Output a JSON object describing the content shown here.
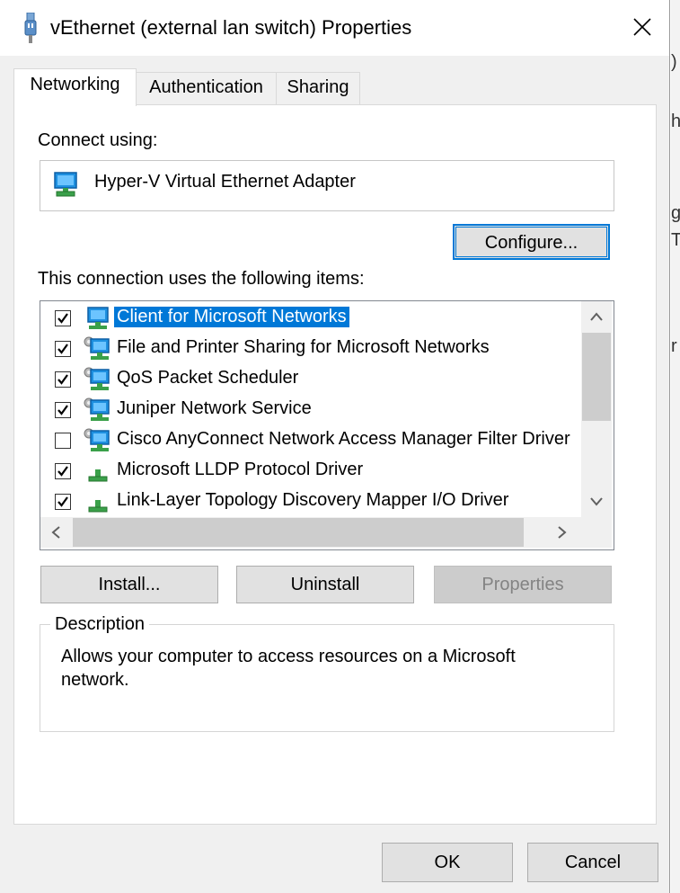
{
  "window": {
    "title": "vEthernet (external lan switch) Properties"
  },
  "background_glyphs": [
    ")",
    "h",
    "g",
    "T",
    "r"
  ],
  "tabs": [
    {
      "label": "Networking",
      "active": true
    },
    {
      "label": "Authentication",
      "active": false
    },
    {
      "label": "Sharing",
      "active": false
    }
  ],
  "connect_using": {
    "label": "Connect using:",
    "adapter": "Hyper-V Virtual Ethernet Adapter",
    "configure_label": "Configure..."
  },
  "items_section": {
    "label": "This connection uses the following items:",
    "items": [
      {
        "label": "Client for Microsoft Networks",
        "checked": true,
        "selected": true,
        "icon": "network-client-icon"
      },
      {
        "label": "File and Printer Sharing for Microsoft Networks",
        "checked": true,
        "selected": false,
        "icon": "network-service-icon"
      },
      {
        "label": "QoS Packet Scheduler",
        "checked": true,
        "selected": false,
        "icon": "network-service-icon"
      },
      {
        "label": "Juniper Network Service",
        "checked": true,
        "selected": false,
        "icon": "network-service-icon"
      },
      {
        "label": "Cisco AnyConnect Network Access Manager Filter Driver",
        "checked": false,
        "selected": false,
        "icon": "network-service-icon"
      },
      {
        "label": "Microsoft LLDP Protocol Driver",
        "checked": true,
        "selected": false,
        "icon": "protocol-icon"
      },
      {
        "label": "Link-Layer Topology Discovery Mapper I/O Driver",
        "checked": true,
        "selected": false,
        "icon": "protocol-icon"
      }
    ]
  },
  "actions": {
    "install_label": "Install...",
    "uninstall_label": "Uninstall",
    "properties_label": "Properties"
  },
  "description": {
    "title": "Description",
    "text": "Allows your computer to access resources on a Microsoft network."
  },
  "footer": {
    "ok_label": "OK",
    "cancel_label": "Cancel"
  }
}
